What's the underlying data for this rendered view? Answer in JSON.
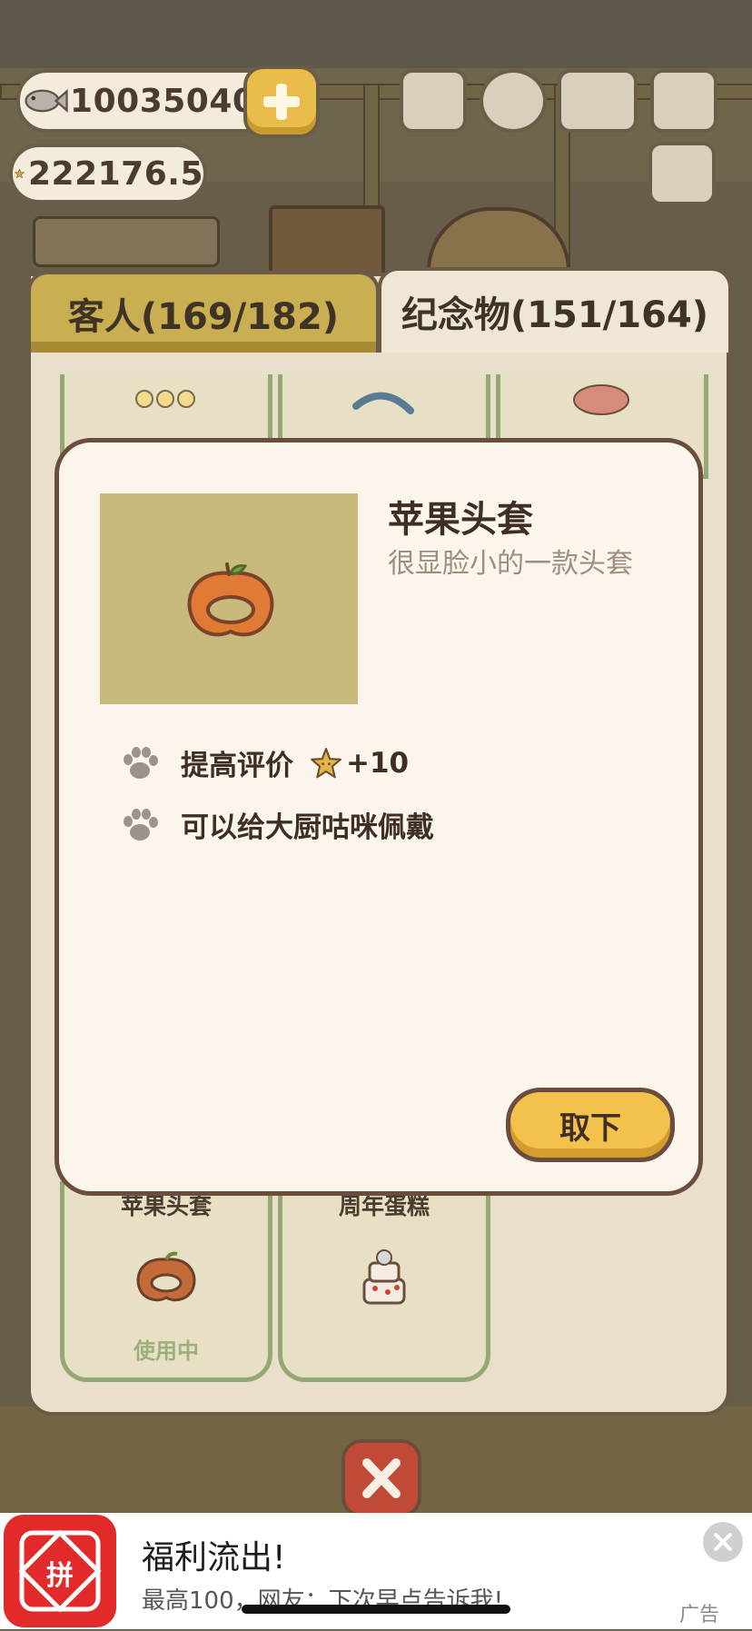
{
  "hud": {
    "fish_currency": "100350408",
    "star_rating": "222176.5"
  },
  "tabs": [
    {
      "label": "客人(169/182)",
      "active": false
    },
    {
      "label": "纪念物(151/164)",
      "active": true
    }
  ],
  "grid_items": [
    {
      "name": "苹果头套",
      "status": "使用中"
    },
    {
      "name": "周年蛋糕",
      "status": ""
    }
  ],
  "modal": {
    "item_name": "苹果头套",
    "item_description": "很显脸小的一款头套",
    "effects": [
      {
        "text": "提高评价",
        "bonus": "+10"
      },
      {
        "text": "可以给大厨咕咪佩戴"
      }
    ],
    "remove_button": "取下"
  },
  "ad": {
    "title": "福利流出!",
    "subtitle": "最高100，网友：下次早点告诉我!",
    "label": "广告",
    "logo_text": "拼"
  },
  "colors": {
    "accent_gold": "#f3c14c",
    "tab_active": "#efe7d6",
    "tab_inactive": "#c9ae52",
    "modal_bg": "#fbf5ec",
    "item_thumb_bg": "#c8b97d",
    "apple_orange": "#e07a35",
    "card_border_green": "#93a874",
    "ad_red": "#e22a2a"
  }
}
